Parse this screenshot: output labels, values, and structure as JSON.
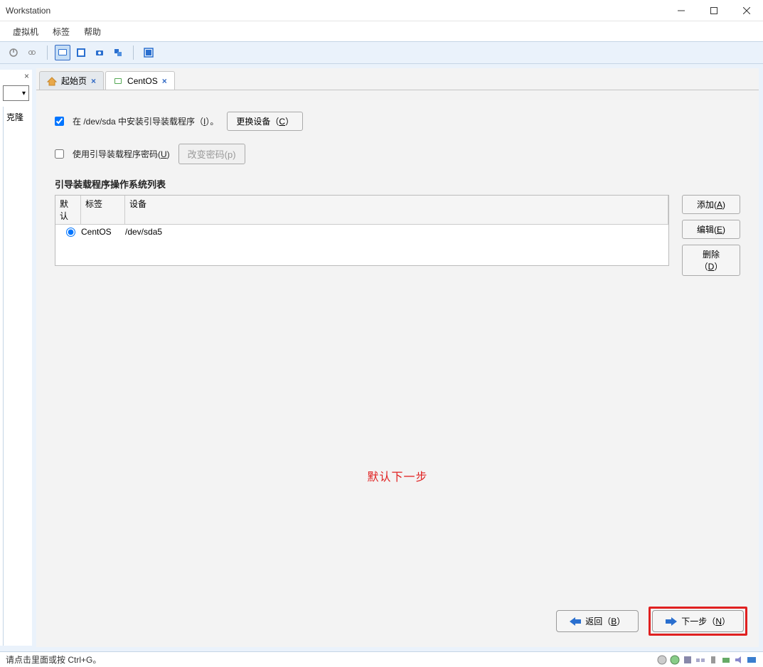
{
  "titlebar": {
    "title": "Workstation"
  },
  "menubar": {
    "items": [
      "虚拟机",
      "标签",
      "帮助"
    ]
  },
  "tabs": [
    {
      "label": "起始页",
      "active": false
    },
    {
      "label": "CentOS",
      "active": true
    }
  ],
  "sidebar": {
    "clone_label": "克隆"
  },
  "content": {
    "install_bootloader": {
      "checked": true,
      "label_pre": "在 /dev/sda 中安装引导装载程序（",
      "accel": "I",
      "label_post": "）。",
      "change_device_btn": "更换设备（",
      "change_device_accel": "C",
      "change_device_post": "）"
    },
    "use_password": {
      "checked": false,
      "label_pre": "使用引导装载程序密码(",
      "accel": "U",
      "label_post": ")",
      "change_pwd_btn": "改变密码(p)"
    },
    "os_list_title": "引导装载程序操作系统列表",
    "table": {
      "headers": [
        "默认",
        "标签",
        "设备"
      ],
      "rows": [
        {
          "default": true,
          "label": "CentOS",
          "device": "/dev/sda5"
        }
      ]
    },
    "side_buttons": {
      "add": {
        "text": "添加(",
        "accel": "A",
        "post": ")"
      },
      "edit": {
        "text": "编辑(",
        "accel": "E",
        "post": ")"
      },
      "delete": {
        "text": "删除（",
        "accel": "D",
        "post": "）"
      }
    },
    "annotation": "默认下一步",
    "nav": {
      "back": {
        "text": "返回（",
        "accel": "B",
        "post": "）"
      },
      "next": {
        "text": "下一步（",
        "accel": "N",
        "post": "）"
      }
    }
  },
  "statusbar": {
    "text": "请点击里面或按 Ctrl+G。"
  }
}
